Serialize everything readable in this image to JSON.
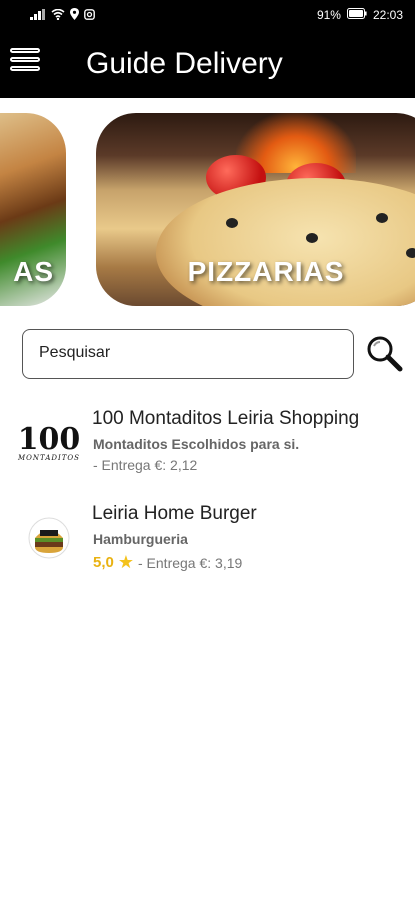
{
  "status_bar": {
    "battery": "91%",
    "time": "22:03"
  },
  "app_bar": {
    "title": "Guide Delivery"
  },
  "categories": [
    {
      "label": "AS"
    },
    {
      "label": "PIZZARIAS"
    }
  ],
  "search": {
    "placeholder": "Pesquisar"
  },
  "restaurants": [
    {
      "logo_text": "100",
      "logo_sub": "MONTADITOS",
      "name": "100 Montaditos Leiria Shopping",
      "subtitle": "Montaditos Escolhidos para si.",
      "rating": "",
      "delivery": "- Entrega €: 2,12"
    },
    {
      "name": "Leiria Home Burger",
      "subtitle": "Hamburgueria",
      "rating": "5,0",
      "delivery": "- Entrega €: 3,19"
    }
  ],
  "colors": {
    "app_bar": "#000000",
    "rating": "#e9b211",
    "star": "#f4c21c"
  }
}
